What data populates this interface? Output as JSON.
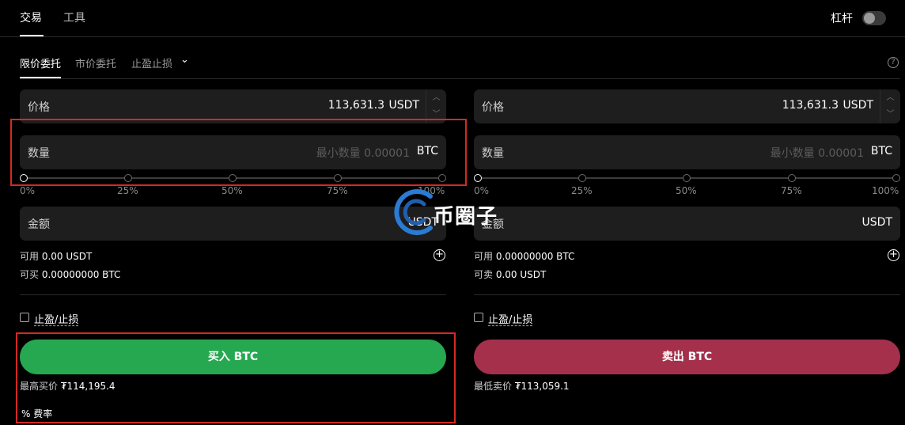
{
  "top_tabs": {
    "trade": "交易",
    "tools": "工具"
  },
  "leverage": {
    "label": "杠杆"
  },
  "order_tabs": {
    "limit": "限价委托",
    "market": "市价委托",
    "tp_sl": "止盈止损",
    "help": "?"
  },
  "buy": {
    "price_label": "价格",
    "price_value": "113,631.3",
    "price_unit": "USDT",
    "qty_label": "数量",
    "qty_placeholder": "最小数量 0.00001",
    "qty_unit": "BTC",
    "slider": [
      "0%",
      "25%",
      "50%",
      "75%",
      "100%"
    ],
    "amount_label": "金额",
    "amount_unit": "USDT",
    "available_label": "可用",
    "available_value": "0.00 USDT",
    "can_buy_label": "可买",
    "can_buy_value": "0.00000000 BTC",
    "tpsl_label": "止盈/止损",
    "button": "买入 BTC",
    "best_label": "最高买价",
    "best_value": "₮114,195.4",
    "fee_icon": "%",
    "fee_label": "费率"
  },
  "sell": {
    "price_label": "价格",
    "price_value": "113,631.3",
    "price_unit": "USDT",
    "qty_label": "数量",
    "qty_placeholder": "最小数量 0.00001",
    "qty_unit": "BTC",
    "slider": [
      "0%",
      "25%",
      "50%",
      "75%",
      "100%"
    ],
    "amount_label": "金额",
    "amount_unit": "USDT",
    "available_label": "可用",
    "available_value": "0.00000000 BTC",
    "can_sell_label": "可卖",
    "can_sell_value": "0.00 USDT",
    "tpsl_label": "止盈/止损",
    "button": "卖出 BTC",
    "best_label": "最低卖价",
    "best_value": "₮113,059.1"
  },
  "watermark": {
    "text": "币圈子"
  },
  "colors": {
    "buy": "#26a850",
    "sell": "#a4304b",
    "highlight_box": "#d42a22"
  }
}
